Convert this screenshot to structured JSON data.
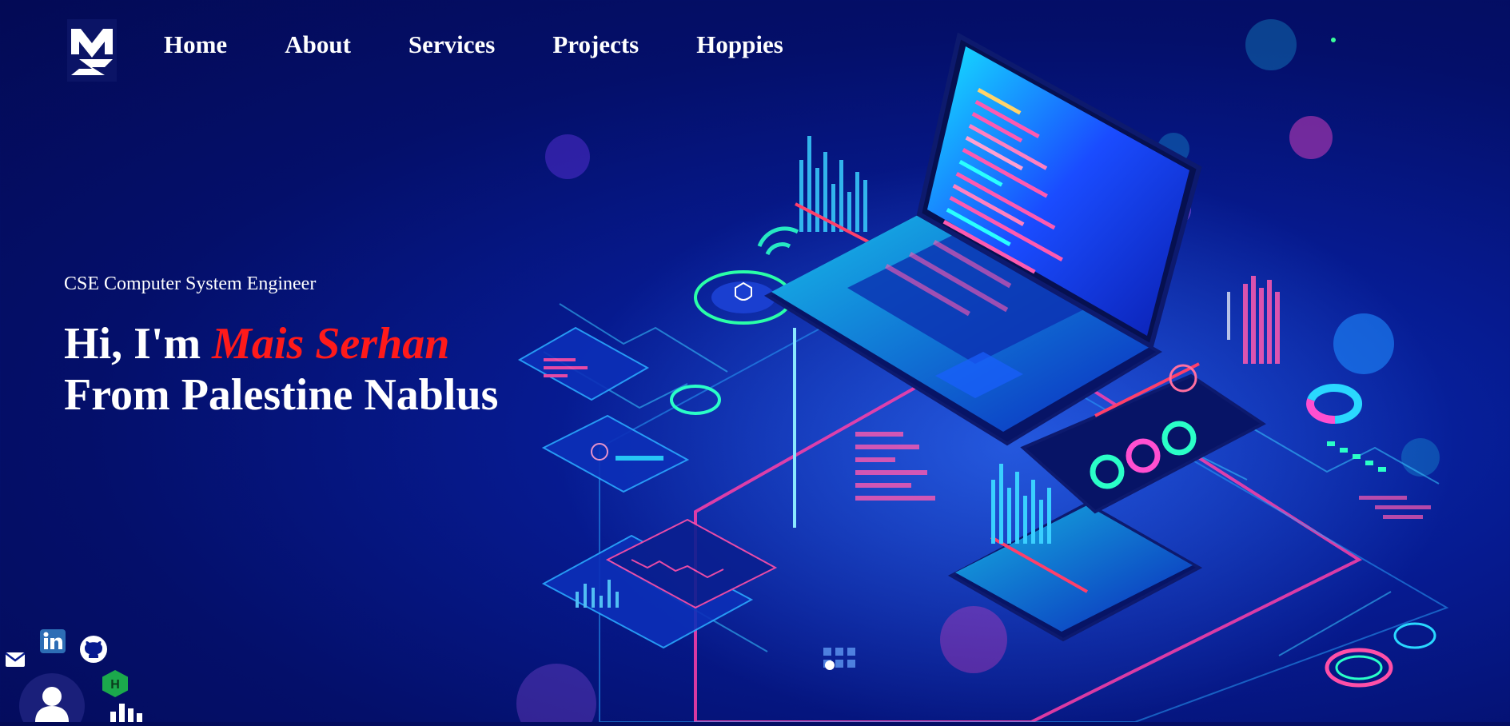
{
  "nav": {
    "items": [
      {
        "label": "Home"
      },
      {
        "label": "About"
      },
      {
        "label": "Services"
      },
      {
        "label": "Projects"
      },
      {
        "label": "Hoppies"
      }
    ]
  },
  "hero": {
    "subtitle": "CSE Computer System Engineer",
    "greeting": "Hi, I'm",
    "name": "Mais Serhan",
    "origin": "From Palestine Nablus"
  },
  "social": {
    "icons": [
      "email-icon",
      "linkedin-icon",
      "github-icon",
      "hackerrank-icon",
      "profile-icon",
      "stats-icon"
    ]
  },
  "colors": {
    "background": "#061a8f",
    "name_accent": "#ff1a1a",
    "text": "#ffffff"
  }
}
